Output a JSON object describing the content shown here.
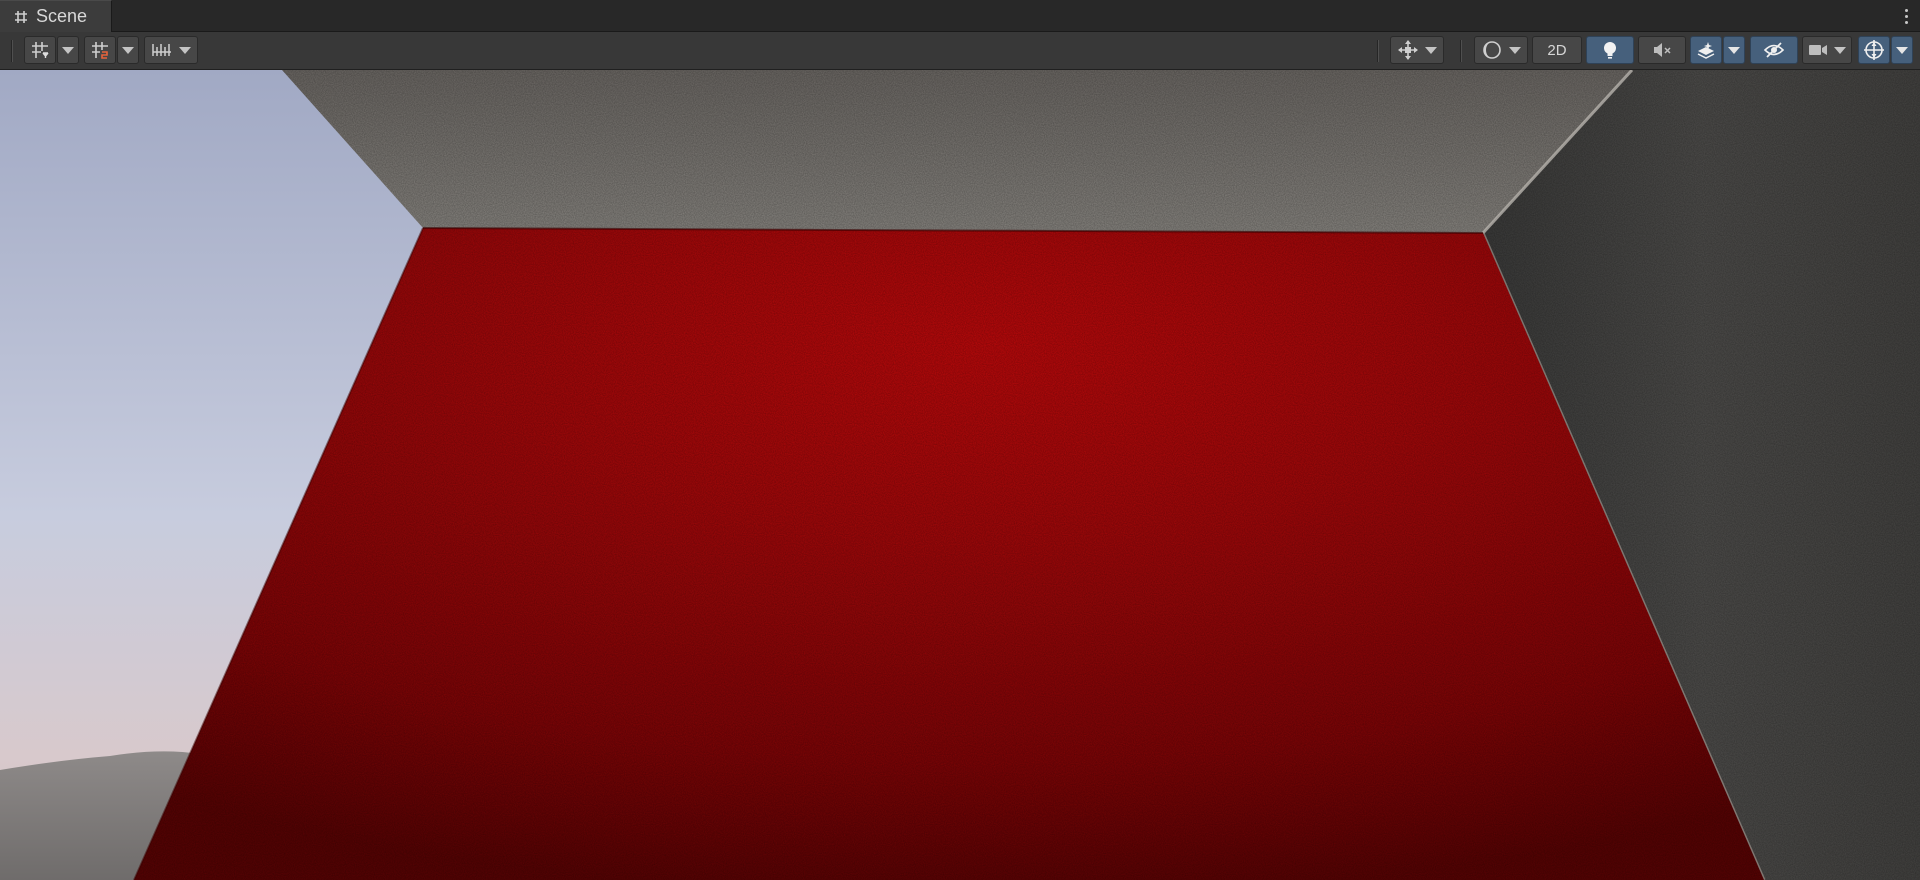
{
  "tab": {
    "title": "Scene",
    "icon": "scene-grid-icon"
  },
  "toolbar": {
    "left": [
      {
        "icon": "grid-snap-icon",
        "dropdown": true
      },
      {
        "icon": "increment-snap-icon",
        "dropdown": true
      },
      {
        "icon": "ruler-icon",
        "dropdown": true
      }
    ],
    "right": [
      {
        "icon": "transform-tool-icon",
        "dropdown": true
      },
      {
        "icon": "shading-mode-icon",
        "dropdown": true
      },
      {
        "label": "2D"
      },
      {
        "icon": "lighting-bulb-icon",
        "active": true
      },
      {
        "icon": "audio-mute-icon"
      },
      {
        "icon": "effects-layers-icon",
        "active": true,
        "dropdown": true
      },
      {
        "icon": "scene-visibility-icon",
        "active": true
      },
      {
        "icon": "camera-icon",
        "dropdown": true
      },
      {
        "icon": "gizmos-icon",
        "active": true,
        "dropdown": true
      }
    ],
    "two_d_label": "2D"
  },
  "colors": {
    "active_button": "#46607c",
    "button": "#474747",
    "toolbar": "#383838",
    "floor_red": "#b20a0c",
    "sky_top": "#a3acc8",
    "sky_horizon": "#d9c8ca"
  }
}
